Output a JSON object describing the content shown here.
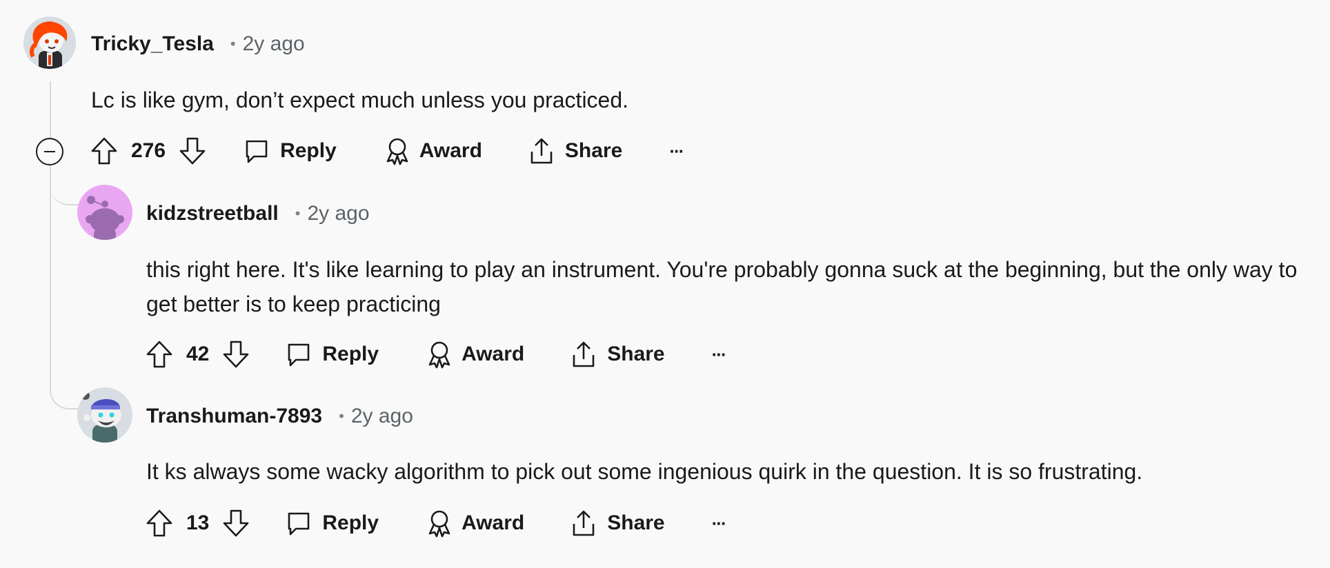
{
  "colors": {
    "background": "#f9f9fa",
    "text_primary": "#1a1a1b",
    "text_secondary": "#5c6366",
    "thread_line": "#d6d9db"
  },
  "actions": {
    "reply_label": "Reply",
    "award_label": "Award",
    "share_label": "Share",
    "more_label": "···"
  },
  "comments": [
    {
      "username": "Tricky_Tesla",
      "separator": "•",
      "age": "2y ago",
      "body": "Lc is like gym, don’t expect much unless you practiced.",
      "score": "276",
      "avatar_icon": "snoo-avatar-red-hair"
    },
    {
      "username": "kidzstreetball",
      "separator": "•",
      "age": "2y ago",
      "body": "this right here. It's like learning to play an instrument. You're probably gonna suck at the beginning, but the only way to get better is to keep practicing",
      "score": "42",
      "avatar_icon": "snoo-avatar-purple"
    },
    {
      "username": "Transhuman-7893",
      "separator": "•",
      "age": "2y ago",
      "body": "It ks always some wacky algorithm to pick out some ingenious quirk in the question. It is so frustrating.",
      "score": "13",
      "avatar_icon": "snoo-avatar-beanie"
    }
  ]
}
